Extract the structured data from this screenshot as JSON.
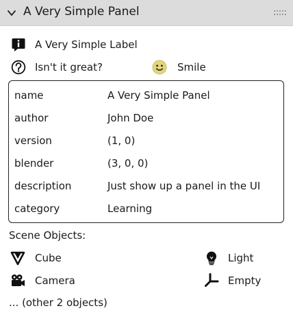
{
  "panel": {
    "title": "A Very Simple Panel"
  },
  "label_row": {
    "text": "A Very Simple Label",
    "icon": "info-icon"
  },
  "question_row": {
    "text": "Isn't it great?",
    "icon": "question-circle-icon"
  },
  "smile_row": {
    "text": "Smile",
    "icon": "smiley-face-icon",
    "icon_color": "#e0d27a"
  },
  "properties": [
    {
      "key": "name",
      "value": "A Very Simple Panel"
    },
    {
      "key": "author",
      "value": "John Doe"
    },
    {
      "key": "version",
      "value": "(1, 0)"
    },
    {
      "key": "blender",
      "value": "(3, 0, 0)"
    },
    {
      "key": "description",
      "value": "Just show up a panel in the UI"
    },
    {
      "key": "category",
      "value": "Learning"
    }
  ],
  "scene": {
    "heading": "Scene Objects:",
    "objects": [
      {
        "name": "Cube",
        "icon": "mesh-cone-icon"
      },
      {
        "name": "Light",
        "icon": "light-bulb-icon"
      },
      {
        "name": "Camera",
        "icon": "camera-icon"
      },
      {
        "name": "Empty",
        "icon": "empty-axes-icon"
      }
    ],
    "more": "... (other 2 objects)"
  }
}
